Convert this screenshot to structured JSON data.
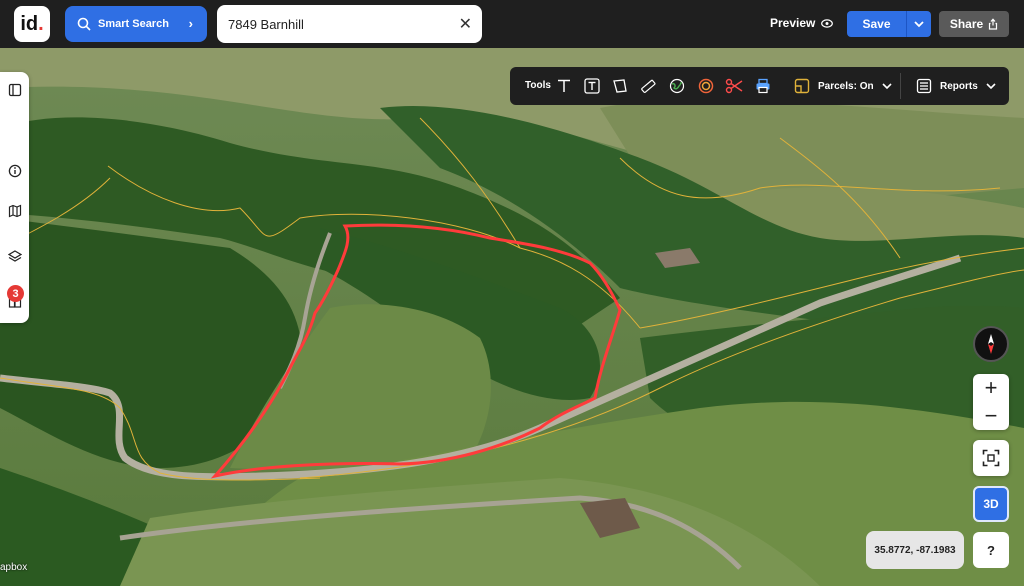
{
  "header": {
    "logo_text": "id",
    "smart_search_label": "Smart Search",
    "address_value": "7849 Barnhill",
    "preview_label": "Preview",
    "save_label": "Save",
    "share_label": "Share"
  },
  "tools": {
    "label": "Tools",
    "items": [
      "text-tool-icon",
      "text-box-tool-icon",
      "polygon-tool-icon",
      "ruler-tool-icon",
      "globe-tool-icon",
      "radius-tool-icon",
      "scissors-tool-icon",
      "print-tool-icon"
    ],
    "parcels_label": "Parcels: On",
    "reports_label": "Reports"
  },
  "left_rail": {
    "items": [
      "sidebar-toggle-icon",
      "info-icon",
      "map-icon",
      "layers-icon",
      "buildings-icon"
    ],
    "badge_count": "3"
  },
  "map_controls": {
    "zoom_in": "+",
    "zoom_out": "−",
    "mode_3d": "3D",
    "help": "?",
    "coordinates": "35.8772, -87.1983",
    "attribution": "apbox"
  },
  "colors": {
    "brand_blue": "#2f6fe4",
    "parcel_outline": "#ff3b3b",
    "parcel_lines": "#e0b23a",
    "badge_red": "#e53935"
  }
}
